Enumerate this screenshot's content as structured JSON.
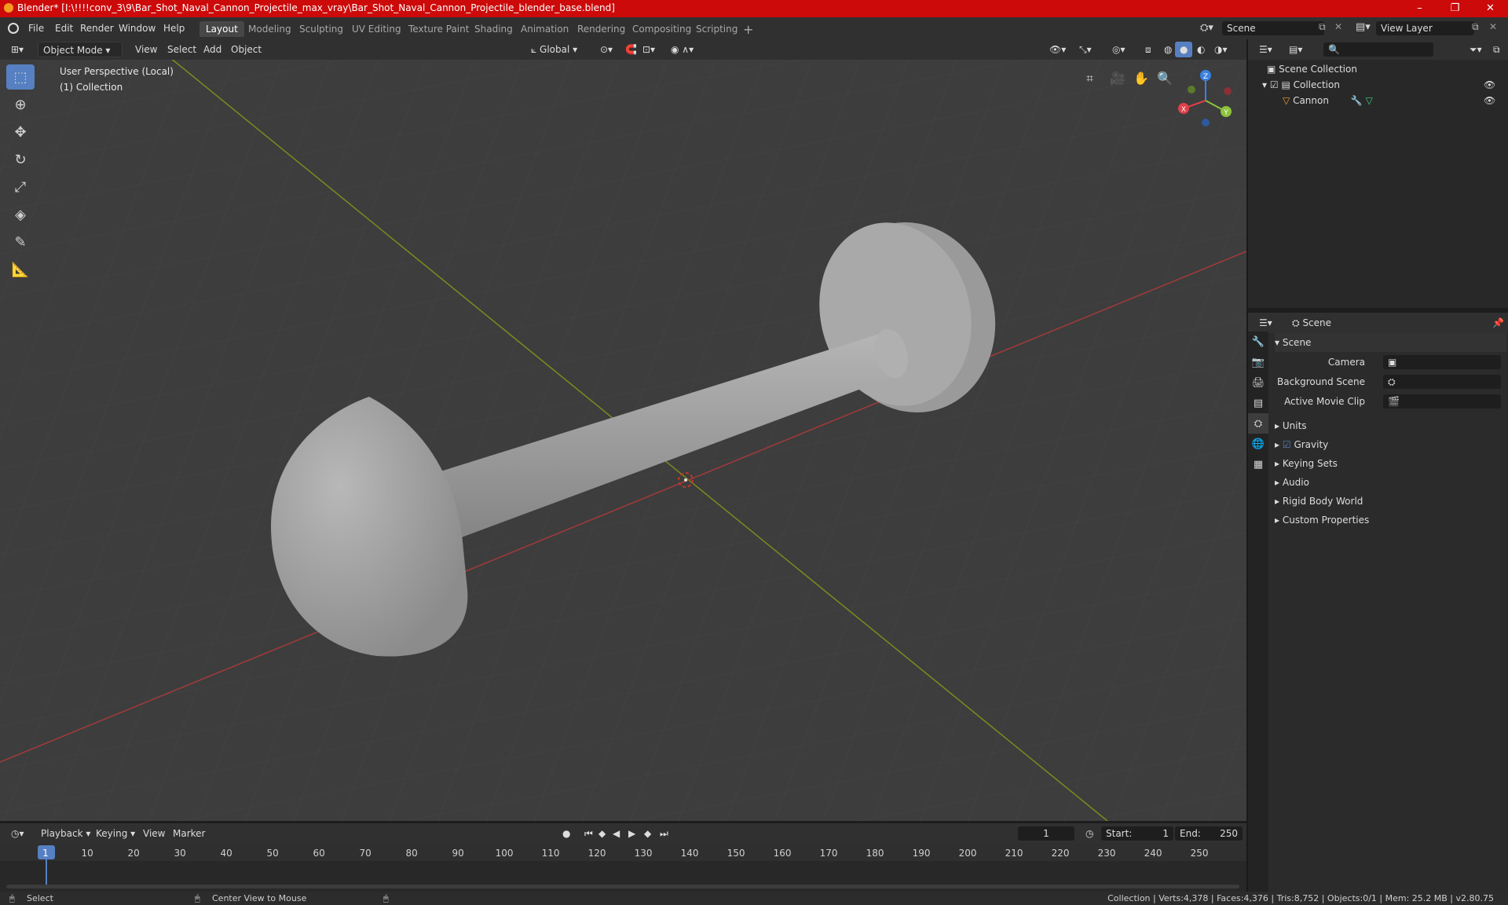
{
  "window": {
    "title": "Blender* [I:\\!!!!conv_3\\9\\Bar_Shot_Naval_Cannon_Projectile_max_vray\\Bar_Shot_Naval_Cannon_Projectile_blender_base.blend]",
    "minimize": "–",
    "maximize": "❐",
    "close": "✕"
  },
  "menu": [
    "File",
    "Edit",
    "Render",
    "Window",
    "Help"
  ],
  "workspaces": [
    "Layout",
    "Modeling",
    "Sculpting",
    "UV Editing",
    "Texture Paint",
    "Shading",
    "Animation",
    "Rendering",
    "Compositing",
    "Scripting"
  ],
  "active_workspace": "Layout",
  "scene_selector": {
    "value": "Scene"
  },
  "view_layer": {
    "value": "View Layer"
  },
  "viewport_header": {
    "mode": "Object Mode",
    "menus": [
      "View",
      "Select",
      "Add",
      "Object"
    ],
    "transform_orientation": "Global"
  },
  "viewport": {
    "perspective_label": "User Perspective (Local)",
    "collection_label": "(1) Collection",
    "gizmo": {
      "x": "X",
      "y": "Y",
      "z": "Z"
    }
  },
  "outliner": {
    "search_placeholder": "",
    "root": "Scene Collection",
    "collection": "Collection",
    "object": "Cannon"
  },
  "properties": {
    "header_title": "Scene",
    "panel_title": "Scene",
    "camera_label": "Camera",
    "background_scene_label": "Background Scene",
    "active_movie_clip_label": "Active Movie Clip",
    "sections": [
      "Units",
      "Gravity",
      "Keying Sets",
      "Audio",
      "Rigid Body World",
      "Custom Properties"
    ],
    "gravity_checked": true
  },
  "timeline": {
    "menus": [
      "Playback",
      "Keying",
      "View",
      "Marker"
    ],
    "current_frame": "1",
    "start_label": "Start:",
    "start_value": "1",
    "end_label": "End:",
    "end_value": "250",
    "ticks": [
      "1",
      "10",
      "20",
      "30",
      "40",
      "50",
      "60",
      "70",
      "80",
      "90",
      "100",
      "110",
      "120",
      "130",
      "140",
      "150",
      "160",
      "170",
      "180",
      "190",
      "200",
      "210",
      "220",
      "230",
      "240",
      "250"
    ]
  },
  "statusbar": {
    "select": "Select",
    "center_view": "Center View to Mouse",
    "stats": "Collection | Verts:4,378 | Faces:4,376 | Tris:8,752 | Objects:0/1 | Mem: 25.2 MB | v2.80.75"
  },
  "colors": {
    "title_bar": "#cc0a0a",
    "accent": "#5680c2",
    "x_axis": "#e0404a",
    "y_axis": "#8cc43c",
    "z_axis": "#3b82e0"
  }
}
